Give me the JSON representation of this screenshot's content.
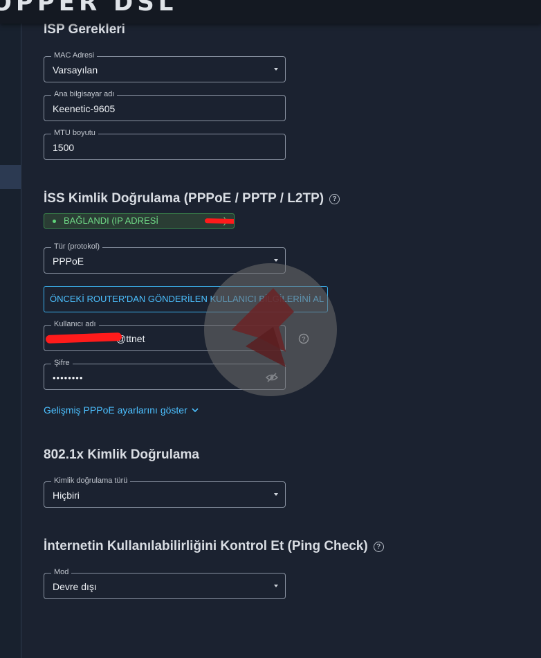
{
  "app": {
    "brand": "OPPER DSL"
  },
  "isp": {
    "heading": "ISP Gerekleri",
    "mac": {
      "label": "MAC Adresi",
      "value": "Varsayılan"
    },
    "hostname": {
      "label": "Ana bilgisayar adı",
      "value": "Keenetic-9605"
    },
    "mtu": {
      "label": "MTU boyutu",
      "value": "1500"
    }
  },
  "auth": {
    "heading": "İSS Kimlik Doğrulama (PPPoE / PPTP / L2TP)",
    "status": "BAĞLANDI (IP ADRESİ",
    "status_close": ")",
    "protocol": {
      "label": "Tür (protokol)",
      "value": "PPPoE"
    },
    "import_button": "ÖNCEKİ ROUTER'DAN GÖNDERİLEN KULLANICI BİLGİLERİNİ AL",
    "username": {
      "label": "Kullanıcı adı",
      "value": "@ttnet"
    },
    "password": {
      "label": "Şifre",
      "value": "••••••••"
    },
    "advanced_link": "Gelişmiş PPPoE ayarlarını göster"
  },
  "dot1x": {
    "heading": "802.1x Kimlik Doğrulama",
    "type": {
      "label": "Kimlik doğrulama türü",
      "value": "Hiçbiri"
    }
  },
  "ping": {
    "heading": "İnternetin Kullanılabilirliğini Kontrol Et (Ping Check)",
    "mode": {
      "label": "Mod",
      "value": "Devre dışı"
    }
  },
  "colors": {
    "accent": "#4cc0ff",
    "success": "#6fd886",
    "redaction": "#ff1b1b"
  },
  "icons": [
    "help-icon",
    "eye-off-icon",
    "chevron-down-icon",
    "dropdown-caret-icon",
    "status-dot-icon"
  ]
}
